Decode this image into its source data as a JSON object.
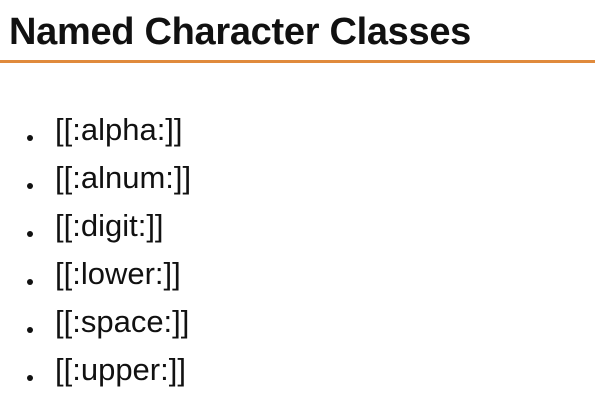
{
  "title": "Named Character Classes",
  "accent_color": "#e08a3c",
  "bullets": [
    "[[:alpha:]]",
    "[[:alnum:]]",
    "[[:digit:]]",
    "[[:lower:]]",
    "[[:space:]]",
    "[[:upper:]]"
  ]
}
